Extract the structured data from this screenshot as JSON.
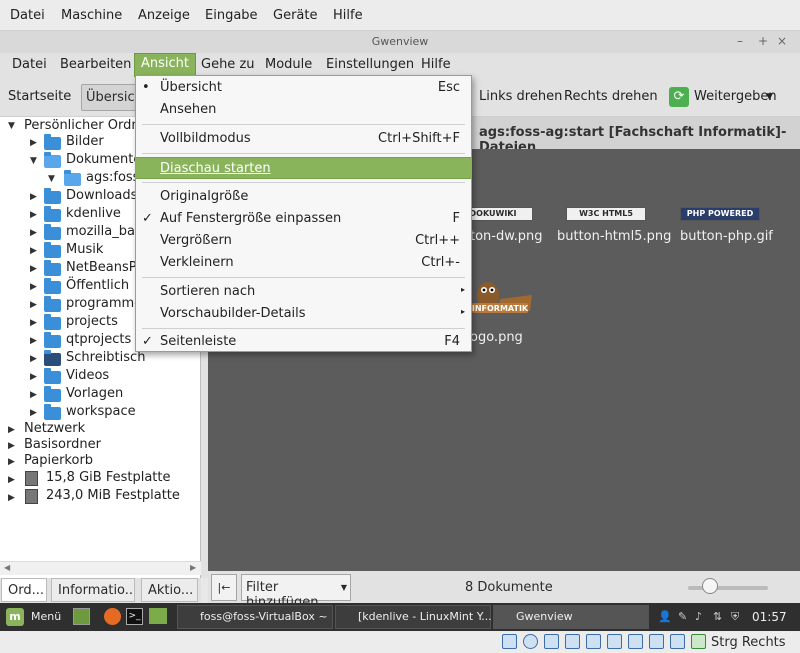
{
  "vbox_menu": [
    "Datei",
    "Maschine",
    "Anzeige",
    "Eingabe",
    "Geräte",
    "Hilfe"
  ],
  "window": {
    "title": "Gwenview",
    "min": "–",
    "max": "+",
    "close": "×"
  },
  "app_menu": [
    "Datei",
    "Bearbeiten",
    "Ansicht",
    "Gehe zu",
    "Module",
    "Einstellungen",
    "Hilfe"
  ],
  "toolbar": {
    "start": "Startseite",
    "overview": "Übersicht",
    "rotate_left": "Links drehen",
    "rotate_right": "Rechts drehen",
    "share": "Weitergeben"
  },
  "dropdown": {
    "items": [
      {
        "label": "Übersicht",
        "shortcut": "Esc",
        "check": "•"
      },
      {
        "label": "Ansehen",
        "shortcut": ""
      },
      {
        "label": "Vollbildmodus",
        "shortcut": "Ctrl+Shift+F"
      },
      {
        "label": "Diaschau starten",
        "shortcut": ""
      },
      {
        "label": "Originalgröße",
        "shortcut": ""
      },
      {
        "label": "Auf Fenstergröße einpassen",
        "shortcut": "F",
        "check": "✓"
      },
      {
        "label": "Vergrößern",
        "shortcut": "Ctrl++"
      },
      {
        "label": "Verkleinern",
        "shortcut": "Ctrl+-"
      },
      {
        "label": "Sortieren nach",
        "submenu": "▸"
      },
      {
        "label": "Vorschaubilder-Details",
        "submenu": "▸"
      },
      {
        "label": "Seitenleiste",
        "shortcut": "F4",
        "check": "✓"
      }
    ]
  },
  "sidebar": {
    "root": "Persönlicher Ordner",
    "folders": [
      "Bilder",
      "Dokumente",
      "ags:foss",
      "Downloads",
      "kdenlive",
      "mozilla_bac",
      "Musik",
      "NetBeansPr",
      "Öffentlich",
      "programme",
      "projects",
      "qtprojects",
      "Schreibtisch",
      "Videos",
      "Vorlagen",
      "workspace"
    ],
    "places": [
      "Netzwerk",
      "Basisordner",
      "Papierkorb",
      "15,8 GiB Festplatte",
      "243,0 MiB Festplatte"
    ],
    "tabs": [
      "Ord...",
      "Informatio...",
      "Aktio..."
    ]
  },
  "main": {
    "header": "ags:foss-ag:start [Fachschaft Informatik]-Dateien",
    "thumbs": [
      {
        "badge": "DOKUWIKI",
        "label": "ton-dw.png"
      },
      {
        "badge": "W3C HTML5",
        "label": "button-html5.png"
      },
      {
        "badge": "PHP POWERED",
        "label": "button-php.gif"
      },
      {
        "badge": "INFORMATIK",
        "label": "ogo.png"
      }
    ]
  },
  "statusbar": {
    "back": "|←",
    "filter": "Filter hinzufügen",
    "count": "8 Dokumente"
  },
  "taskbar": {
    "menu": "Menü",
    "items": [
      "foss@foss-VirtualBox ~",
      "[kdenlive - LinuxMint Y...",
      "Gwenview"
    ],
    "clock": "01:57"
  },
  "vbox_status": {
    "host_key": "Strg Rechts"
  }
}
